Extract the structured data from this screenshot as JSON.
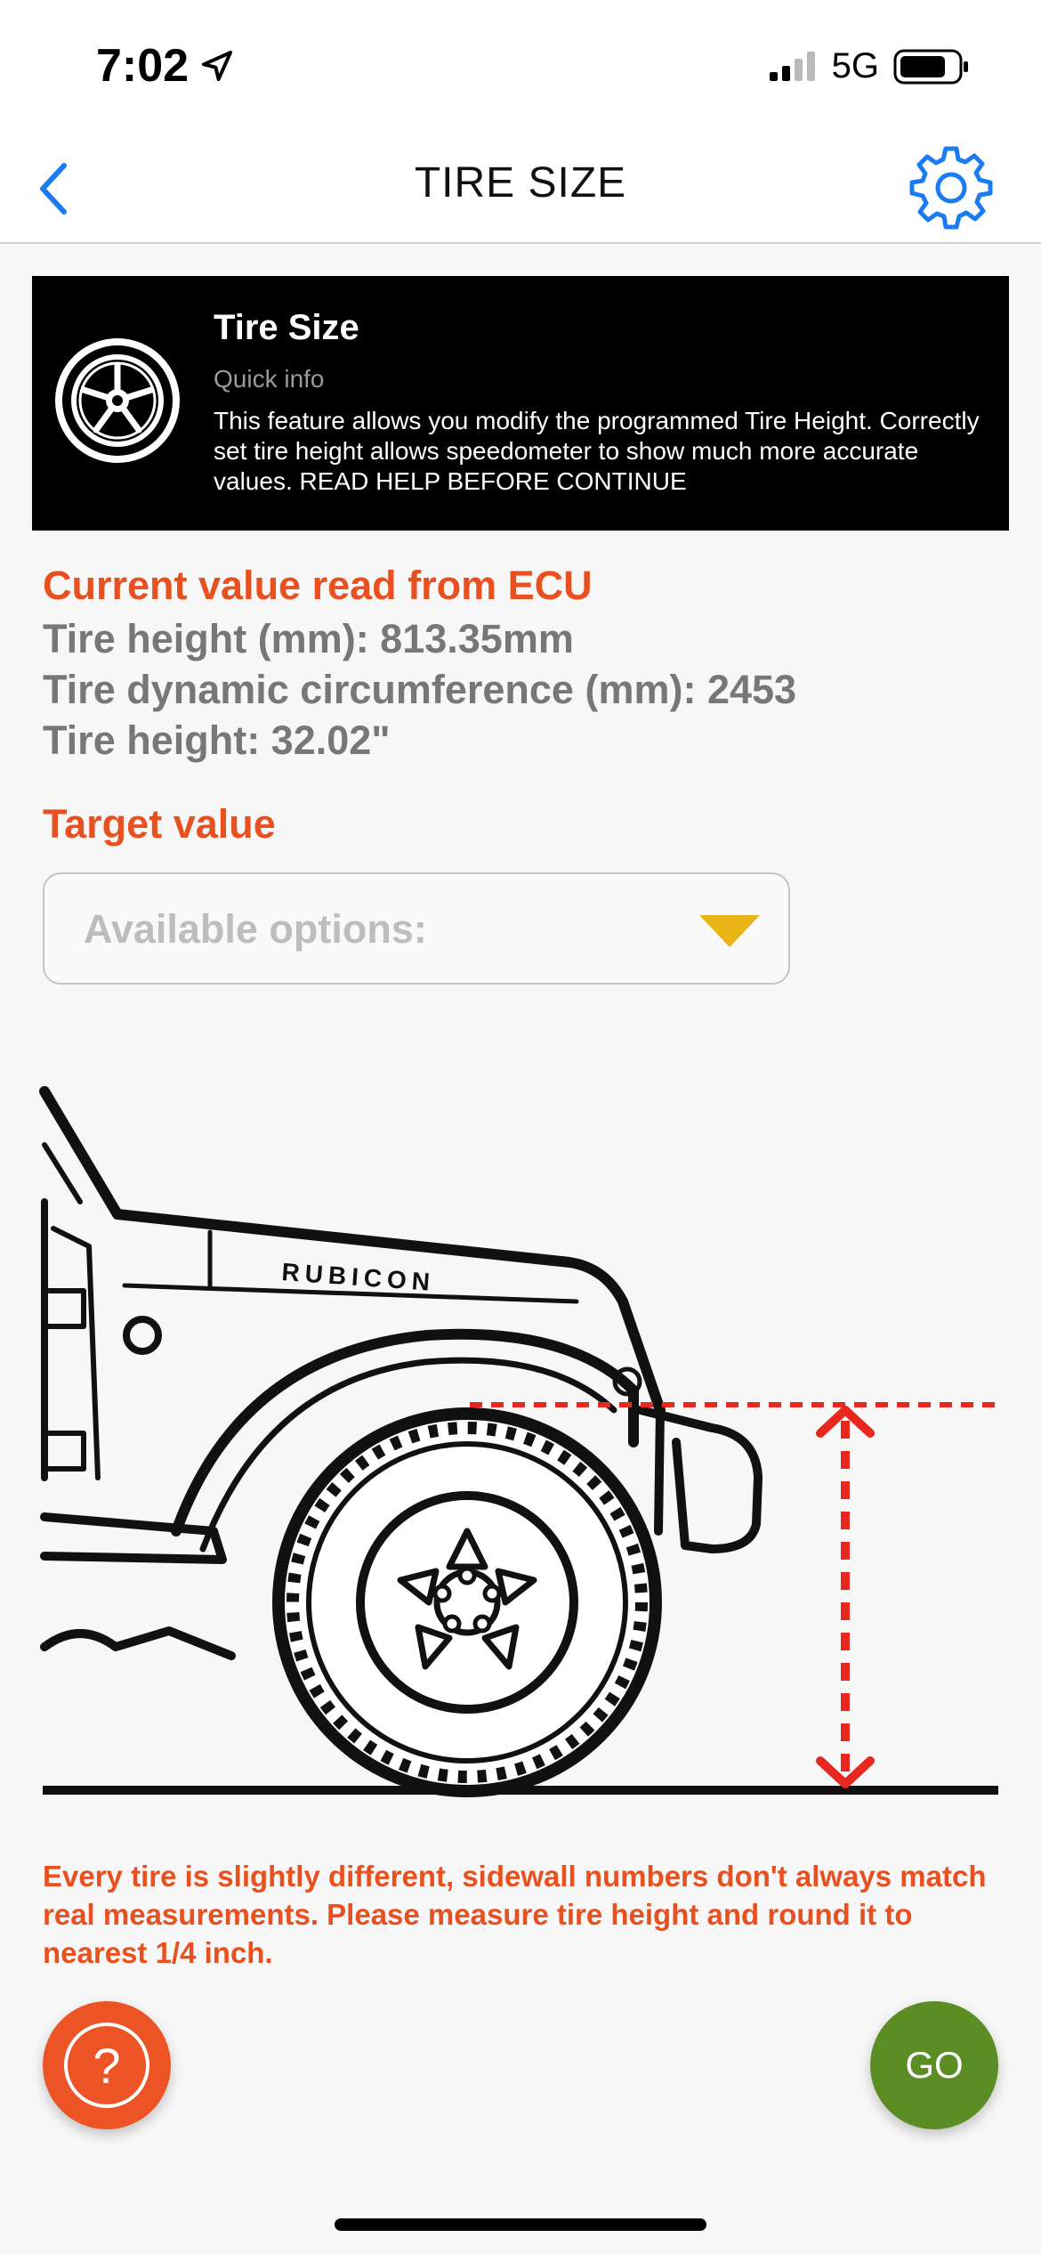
{
  "status_bar": {
    "time": "7:02",
    "network": "5G"
  },
  "nav": {
    "title": "TIRE SIZE"
  },
  "info_banner": {
    "title": "Tire Size",
    "subtitle": "Quick info",
    "description": "This feature allows you modify the programmed Tire Height. Correctly set tire height allows speedometer to show much more accurate values.  READ HELP BEFORE CONTINUE"
  },
  "current": {
    "heading": "Current value read from ECU",
    "lines": [
      "Tire height (mm): 813.35mm",
      "Tire dynamic circumference (mm): 2453",
      "Tire height: 32.02\""
    ]
  },
  "target": {
    "heading": "Target value",
    "placeholder": "Available options:"
  },
  "illustration": {
    "badge_text": "RUBICON"
  },
  "notice": "Every tire is slightly different, sidewall numbers don't always match real measurements. Please measure tire height and round it to nearest 1/4 inch.",
  "actions": {
    "help_symbol": "?",
    "go_label": "GO"
  },
  "colors": {
    "accent_orange": "#e8511f",
    "go_green": "#5c8c24",
    "ios_blue": "#1a7cf0",
    "dropdown_arrow": "#e8b416",
    "measure_red": "#e8271f"
  },
  "icons": [
    "location-arrow-icon",
    "signal-icon",
    "battery-icon",
    "chevron-left-icon",
    "gear-icon",
    "wheel-icon",
    "dropdown-triangle-icon",
    "question-icon"
  ]
}
